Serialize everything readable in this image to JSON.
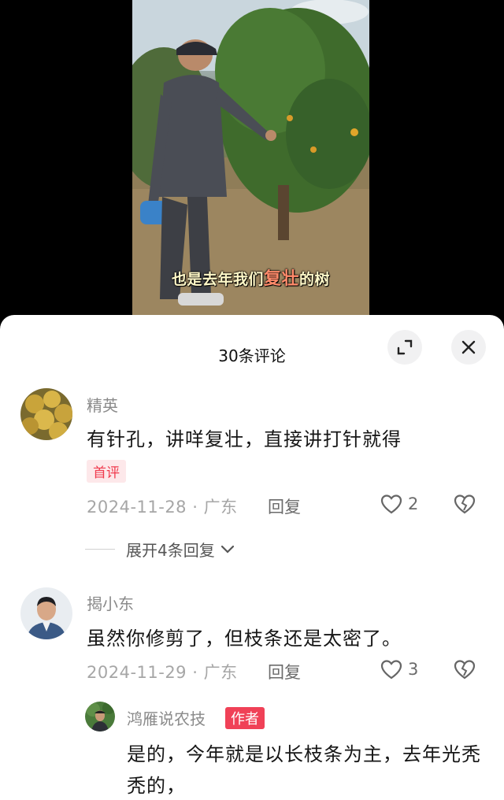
{
  "video": {
    "subtitle_before": "也是去年我们",
    "subtitle_highlight": "复壮",
    "subtitle_after": "的树"
  },
  "comments_panel": {
    "title": "30条评论"
  },
  "comments": [
    {
      "username": "精英",
      "text": "有针孔，讲咩复壮，直接讲打针就得",
      "badge": "首评",
      "date": "2024-11-28",
      "separator": "·",
      "location": "广东",
      "reply_label": "回复",
      "likes": "2",
      "expand_label": "展开4条回复"
    },
    {
      "username": "揭小东",
      "text": "虽然你修剪了，但枝条还是太密了。",
      "date": "2024-11-29",
      "separator": "·",
      "location": "广东",
      "reply_label": "回复",
      "likes": "3"
    }
  ],
  "author_reply": {
    "username": "鸿雁说农技",
    "badge": "作者",
    "text": "是的，今年就是以长枝条为主，去年光秃秃的，"
  },
  "colors": {
    "accent_red": "#f04157",
    "first_badge_bg": "#fde8ea",
    "meta_gray": "#a6a6a6"
  },
  "icons": [
    "expand-icon",
    "close-icon",
    "heart-icon",
    "broken-heart-icon",
    "chevron-down-icon"
  ]
}
